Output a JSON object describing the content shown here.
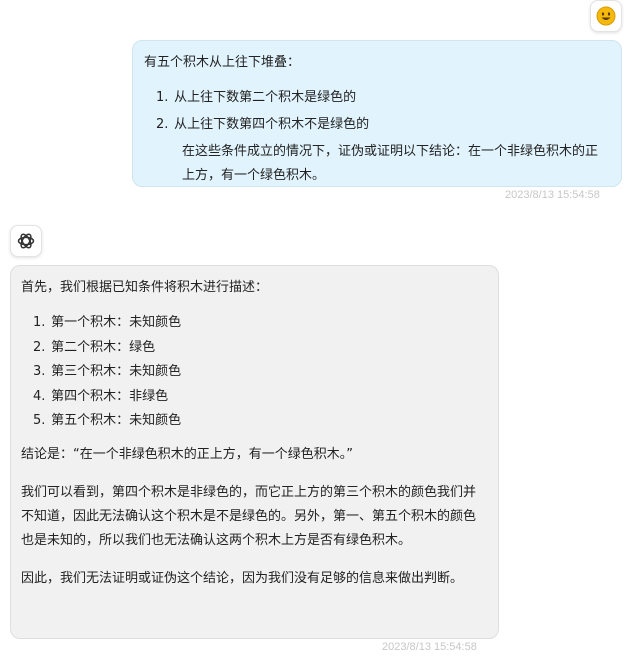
{
  "user_message": {
    "avatar_icon": "smiley-face-icon",
    "intro": "有五个积木从上往下堆叠：",
    "items": [
      {
        "num": "1.",
        "text": "从上往下数第二个积木是绿色的"
      },
      {
        "num": "2.",
        "text": "从上往下数第四个积木不是绿色的"
      }
    ],
    "continuation": "在这些条件成立的情况下，证伪或证明以下结论：在一个非绿色积木的正上方，有一个绿色积木。",
    "timestamp": "2023/8/13 15:54:58"
  },
  "bot_message": {
    "avatar_icon": "chatgpt-logo-icon",
    "intro": "首先，我们根据已知条件将积木进行描述：",
    "items": [
      {
        "num": "1.",
        "text": "第一个积木：未知颜色"
      },
      {
        "num": "2.",
        "text": "第二个积木：绿色"
      },
      {
        "num": "3.",
        "text": "第三个积木：未知颜色"
      },
      {
        "num": "4.",
        "text": "第四个积木：非绿色"
      },
      {
        "num": "5.",
        "text": "第五个积木：未知颜色"
      }
    ],
    "conclusion": "结论是：“在一个非绿色积木的正上方，有一个绿色积木。”",
    "paragraph1": "我们可以看到，第四个积木是非绿色的，而它正上方的第三个积木的颜色我们并不知道，因此无法确认这个积木是不是绿色的。另外，第一、第五个积木的颜色也是未知的，所以我们也无法确认这两个积木上方是否有绿色积木。",
    "paragraph2": "因此，我们无法证明或证伪这个结论，因为我们没有足够的信息来做出判断。",
    "timestamp": "2023/8/13 15:54:58"
  },
  "colors": {
    "user_bubble_bg": "#e1f4fd",
    "bot_bubble_bg": "#f1f1f1",
    "timestamp": "#c7c7c7",
    "emoji_yellow": "#f5b90e"
  }
}
